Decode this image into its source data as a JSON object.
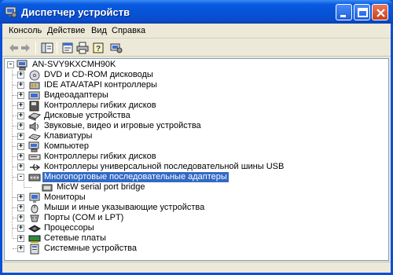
{
  "window": {
    "title": "Диспетчер устройств"
  },
  "menu": [
    "Консоль",
    "Действие",
    "Вид",
    "Справка"
  ],
  "tree": {
    "root": "AN-SVY9KXCMH90K",
    "items": [
      {
        "label": "DVD и CD-ROM дисководы",
        "icon": "cdrom-icon",
        "expander": "+"
      },
      {
        "label": "IDE ATA/ATAPI контроллеры",
        "icon": "ide-controller-icon",
        "expander": "+"
      },
      {
        "label": "Видеоадаптеры",
        "icon": "display-adapter-icon",
        "expander": "+"
      },
      {
        "label": "Контроллеры гибких дисков",
        "icon": "floppy-controller-icon",
        "expander": "+"
      },
      {
        "label": "Дисковые устройства",
        "icon": "disk-drive-icon",
        "expander": "+"
      },
      {
        "label": "Звуковые, видео и игровые устройства",
        "icon": "sound-icon",
        "expander": "+"
      },
      {
        "label": "Клавиатуры",
        "icon": "keyboard-icon",
        "expander": "+"
      },
      {
        "label": "Компьютер",
        "icon": "computer-icon",
        "expander": "+"
      },
      {
        "label": "Контроллеры гибких дисков",
        "icon": "floppy-drive-icon",
        "expander": "+"
      },
      {
        "label": "Контроллеры универсальной последовательной шины USB",
        "icon": "usb-icon",
        "expander": "+"
      },
      {
        "label": "Многопортовые последовательные адаптеры",
        "icon": "multiport-serial-icon",
        "expander": "-",
        "selected": true,
        "children": [
          {
            "label": "MicW serial port bridge",
            "icon": "serial-bridge-icon"
          }
        ]
      },
      {
        "label": "Мониторы",
        "icon": "monitor-icon",
        "expander": "+"
      },
      {
        "label": "Мыши и иные указывающие устройства",
        "icon": "mouse-icon",
        "expander": "+"
      },
      {
        "label": "Порты (COM и LPT)",
        "icon": "port-icon",
        "expander": "+"
      },
      {
        "label": "Процессоры",
        "icon": "processor-icon",
        "expander": "+"
      },
      {
        "label": "Сетевые платы",
        "icon": "network-card-icon",
        "expander": "+"
      },
      {
        "label": "Системные устройства",
        "icon": "system-devices-icon",
        "expander": "+"
      }
    ]
  },
  "colors": {
    "selection": "#316ac5",
    "titlebar": "#0554d8"
  }
}
